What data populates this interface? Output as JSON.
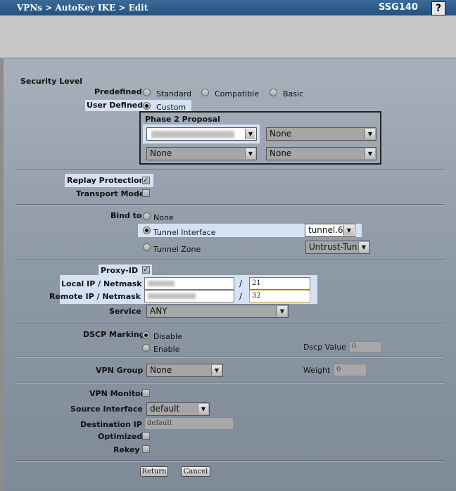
{
  "titlebar": {
    "breadcrumb": "VPNs > AutoKey IKE > Edit",
    "model": "SSG140",
    "help": "?"
  },
  "security_level": {
    "heading": "Security Level",
    "predefined_label": "Predefined",
    "opt_standard": "Standard",
    "opt_compatible": "Compatible",
    "opt_basic": "Basic",
    "user_defined_label": "User Defined",
    "opt_custom": "Custom",
    "phase2_heading": "Phase 2 Proposal",
    "proposal_2": "None",
    "proposal_3": "None",
    "proposal_4": "None"
  },
  "replay": {
    "label": "Replay Protection",
    "checked": true
  },
  "transport": {
    "label": "Transport Mode",
    "checked": false
  },
  "bind": {
    "label": "Bind to",
    "opt_none": "None",
    "opt_tunnel_interface": "Tunnel Interface",
    "tunnel_interface_value": "tunnel.6",
    "opt_tunnel_zone": "Tunnel Zone",
    "tunnel_zone_value": "Untrust-Tun"
  },
  "proxy": {
    "label": "Proxy-ID",
    "local_label": "Local IP / Netmask",
    "local_mask": "21",
    "remote_label": "Remote IP / Netmask",
    "remote_mask": "32",
    "slash": "/",
    "service_label": "Service",
    "service_value": "ANY"
  },
  "dscp": {
    "label": "DSCP Marking",
    "opt_disable": "Disable",
    "opt_enable": "Enable",
    "value_label": "Dscp Value",
    "value": "0"
  },
  "vpn_group": {
    "label": "VPN Group",
    "value": "None",
    "weight_label": "Weight",
    "weight_value": "0"
  },
  "monitor": {
    "vpn_monitor_label": "VPN Monitor",
    "source_interface_label": "Source Interface",
    "source_interface_value": "default",
    "destination_ip_label": "Destination IP",
    "destination_ip_value": "default",
    "optimized_label": "Optimized",
    "rekey_label": "Rekey"
  },
  "buttons": {
    "return": "Return",
    "cancel": "Cancel"
  },
  "colors": {
    "titlebar": "#25527f",
    "highlight": "#d5e2f3",
    "panel": "#8e99a6"
  }
}
